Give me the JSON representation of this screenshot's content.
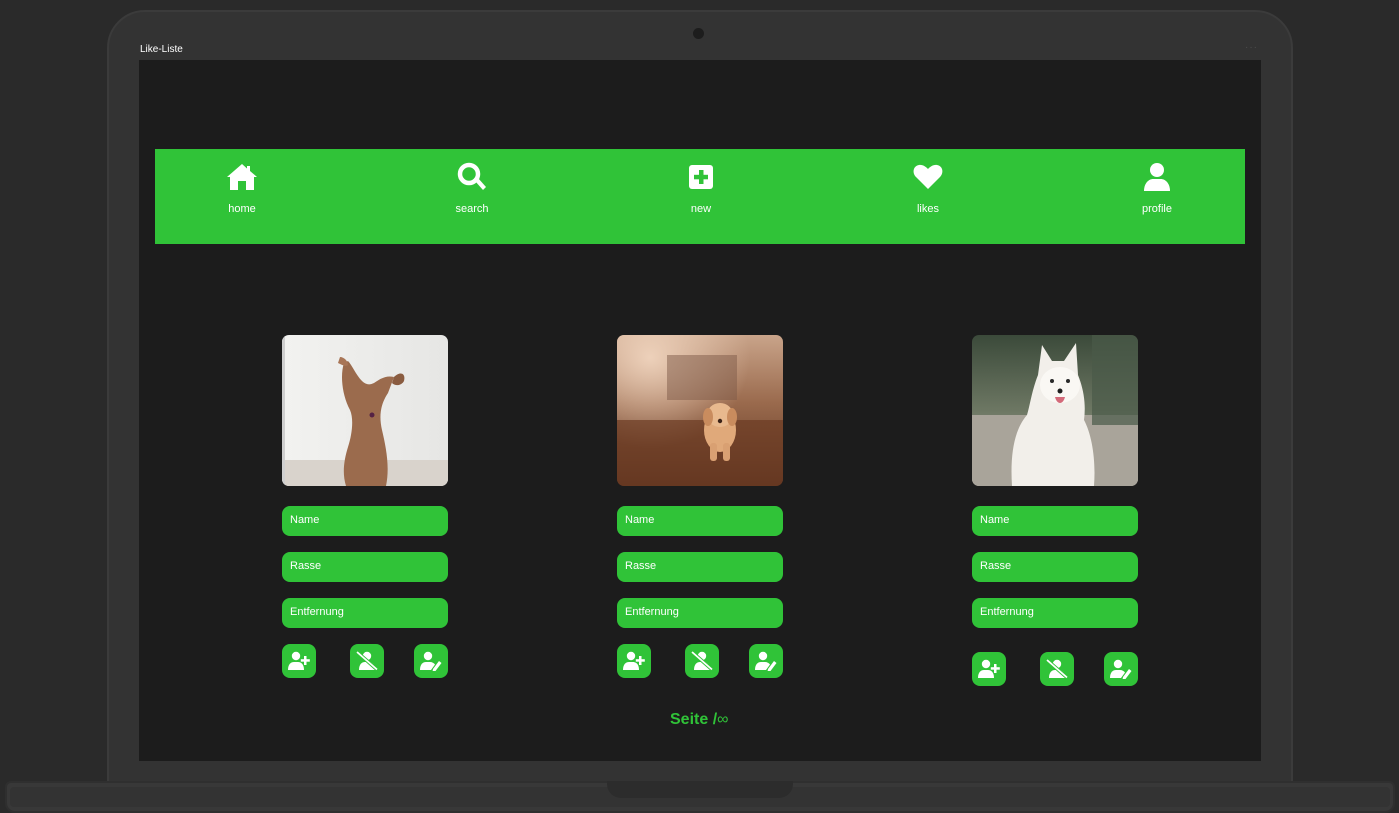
{
  "window": {
    "title": "Like-Liste",
    "menu_dots": "···"
  },
  "nav": {
    "items": [
      {
        "label": "home",
        "icon": "home-icon"
      },
      {
        "label": "search",
        "icon": "search-icon"
      },
      {
        "label": "new",
        "icon": "plus-square-icon"
      },
      {
        "label": "likes",
        "icon": "heart-icon"
      },
      {
        "label": "profile",
        "icon": "user-icon"
      }
    ]
  },
  "cards": [
    {
      "fields": {
        "name": "Name",
        "breed": "Rasse",
        "distance": "Entfernung"
      },
      "photo": "dog-raising-paw"
    },
    {
      "fields": {
        "name": "Name",
        "breed": "Rasse",
        "distance": "Entfernung"
      },
      "photo": "golden-puppy-running"
    },
    {
      "fields": {
        "name": "Name",
        "breed": "Rasse",
        "distance": "Entfernung"
      },
      "photo": "white-samoyed-sitting"
    }
  ],
  "card_actions": [
    "user-plus-icon",
    "user-slash-icon",
    "user-edit-icon"
  ],
  "pager": {
    "label": "Seite /",
    "total": "∞"
  },
  "colors": {
    "accent": "#30c338",
    "screen": "#1c1c1c",
    "frame": "#333333"
  }
}
